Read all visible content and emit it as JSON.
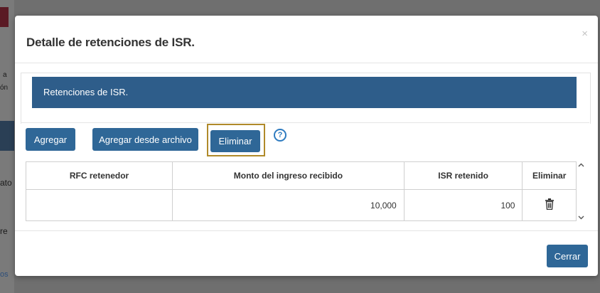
{
  "modal": {
    "title": "Detalle de retenciones de ISR.",
    "close_label": "×"
  },
  "panel": {
    "heading": "Retenciones de ISR."
  },
  "toolbar": {
    "agregar_label": "Agregar",
    "agregar_archivo_label": "Agregar desde archivo",
    "eliminar_label": "Eliminar",
    "help_label": "?"
  },
  "table": {
    "headers": [
      "RFC retenedor",
      "Monto del ingreso recibido",
      "ISR retenido",
      "Eliminar"
    ],
    "rows": [
      {
        "rfc": "",
        "monto": "10,000",
        "isr": "100"
      }
    ]
  },
  "footer": {
    "cerrar_label": "Cerrar"
  },
  "background": {
    "fragments": [
      "a",
      "ón",
      "ato",
      "re",
      "os"
    ]
  },
  "colors": {
    "accent": "#2f6797",
    "panel_heading": "#2e5d8a",
    "highlight_border": "#b08a2a",
    "help": "#2e7bc0"
  }
}
